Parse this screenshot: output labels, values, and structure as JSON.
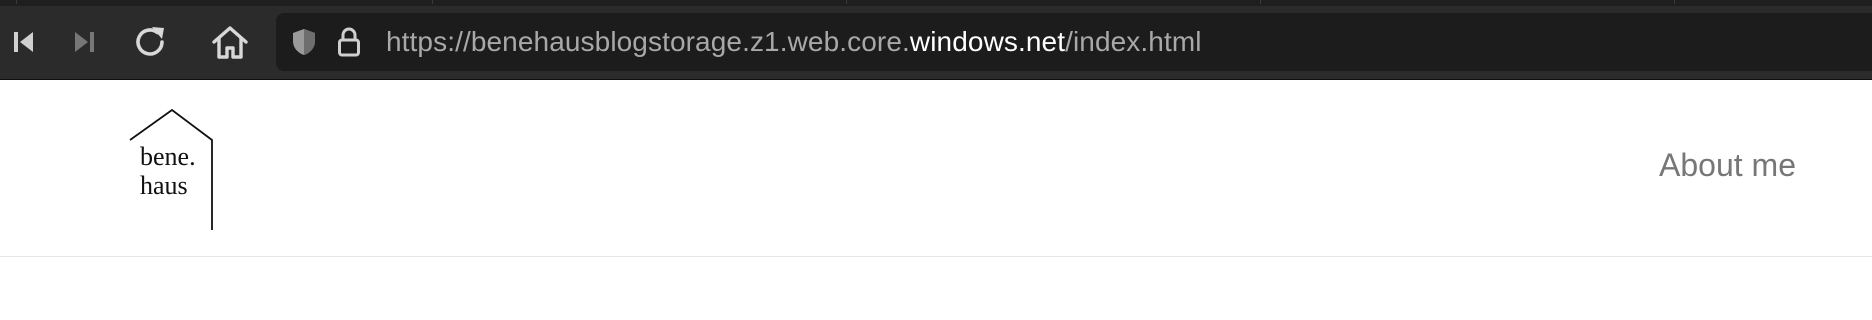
{
  "browser": {
    "toolbar_icons": [
      "skip-back-icon",
      "skip-forward-icon",
      "reload-icon",
      "home-icon"
    ],
    "url": {
      "prefix": "https://benehausblogstorage.z1.web.core.",
      "domain": "windows.net",
      "path": "/index.html"
    },
    "security_icons": [
      "shield-icon",
      "lock-icon"
    ]
  },
  "site": {
    "logo": {
      "line1": "bene.",
      "line2": "haus"
    },
    "nav": {
      "about_label": "About me"
    }
  },
  "colors": {
    "toolbar_bg": "#2b2b2b",
    "urlbar_bg": "#1c1c1c",
    "url_dim": "#a8a8a8",
    "url_domain": "#ffffff",
    "nav_link": "#777777",
    "divider": "#e6e6e6"
  }
}
